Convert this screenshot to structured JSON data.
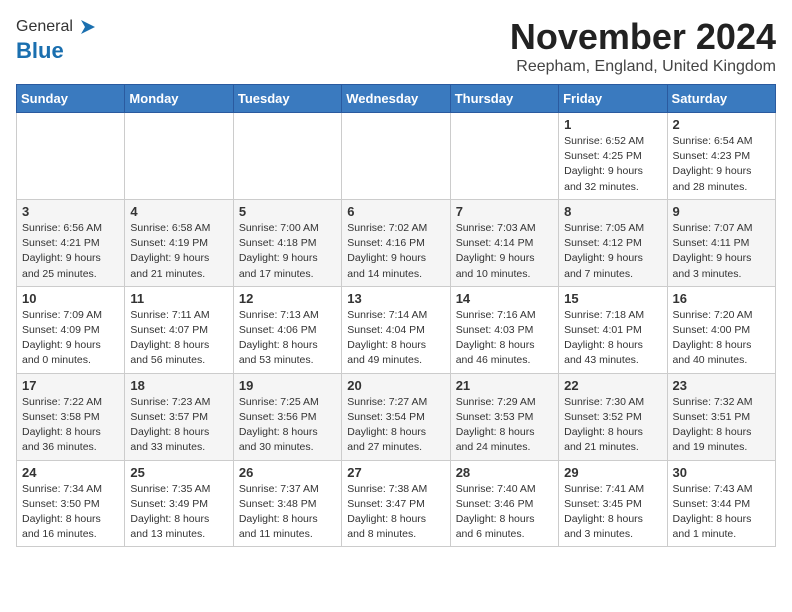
{
  "logo": {
    "general": "General",
    "blue": "Blue"
  },
  "title": "November 2024",
  "location": "Reepham, England, United Kingdom",
  "days_header": [
    "Sunday",
    "Monday",
    "Tuesday",
    "Wednesday",
    "Thursday",
    "Friday",
    "Saturday"
  ],
  "weeks": [
    [
      {
        "day": "",
        "detail": ""
      },
      {
        "day": "",
        "detail": ""
      },
      {
        "day": "",
        "detail": ""
      },
      {
        "day": "",
        "detail": ""
      },
      {
        "day": "",
        "detail": ""
      },
      {
        "day": "1",
        "detail": "Sunrise: 6:52 AM\nSunset: 4:25 PM\nDaylight: 9 hours\nand 32 minutes."
      },
      {
        "day": "2",
        "detail": "Sunrise: 6:54 AM\nSunset: 4:23 PM\nDaylight: 9 hours\nand 28 minutes."
      }
    ],
    [
      {
        "day": "3",
        "detail": "Sunrise: 6:56 AM\nSunset: 4:21 PM\nDaylight: 9 hours\nand 25 minutes."
      },
      {
        "day": "4",
        "detail": "Sunrise: 6:58 AM\nSunset: 4:19 PM\nDaylight: 9 hours\nand 21 minutes."
      },
      {
        "day": "5",
        "detail": "Sunrise: 7:00 AM\nSunset: 4:18 PM\nDaylight: 9 hours\nand 17 minutes."
      },
      {
        "day": "6",
        "detail": "Sunrise: 7:02 AM\nSunset: 4:16 PM\nDaylight: 9 hours\nand 14 minutes."
      },
      {
        "day": "7",
        "detail": "Sunrise: 7:03 AM\nSunset: 4:14 PM\nDaylight: 9 hours\nand 10 minutes."
      },
      {
        "day": "8",
        "detail": "Sunrise: 7:05 AM\nSunset: 4:12 PM\nDaylight: 9 hours\nand 7 minutes."
      },
      {
        "day": "9",
        "detail": "Sunrise: 7:07 AM\nSunset: 4:11 PM\nDaylight: 9 hours\nand 3 minutes."
      }
    ],
    [
      {
        "day": "10",
        "detail": "Sunrise: 7:09 AM\nSunset: 4:09 PM\nDaylight: 9 hours\nand 0 minutes."
      },
      {
        "day": "11",
        "detail": "Sunrise: 7:11 AM\nSunset: 4:07 PM\nDaylight: 8 hours\nand 56 minutes."
      },
      {
        "day": "12",
        "detail": "Sunrise: 7:13 AM\nSunset: 4:06 PM\nDaylight: 8 hours\nand 53 minutes."
      },
      {
        "day": "13",
        "detail": "Sunrise: 7:14 AM\nSunset: 4:04 PM\nDaylight: 8 hours\nand 49 minutes."
      },
      {
        "day": "14",
        "detail": "Sunrise: 7:16 AM\nSunset: 4:03 PM\nDaylight: 8 hours\nand 46 minutes."
      },
      {
        "day": "15",
        "detail": "Sunrise: 7:18 AM\nSunset: 4:01 PM\nDaylight: 8 hours\nand 43 minutes."
      },
      {
        "day": "16",
        "detail": "Sunrise: 7:20 AM\nSunset: 4:00 PM\nDaylight: 8 hours\nand 40 minutes."
      }
    ],
    [
      {
        "day": "17",
        "detail": "Sunrise: 7:22 AM\nSunset: 3:58 PM\nDaylight: 8 hours\nand 36 minutes."
      },
      {
        "day": "18",
        "detail": "Sunrise: 7:23 AM\nSunset: 3:57 PM\nDaylight: 8 hours\nand 33 minutes."
      },
      {
        "day": "19",
        "detail": "Sunrise: 7:25 AM\nSunset: 3:56 PM\nDaylight: 8 hours\nand 30 minutes."
      },
      {
        "day": "20",
        "detail": "Sunrise: 7:27 AM\nSunset: 3:54 PM\nDaylight: 8 hours\nand 27 minutes."
      },
      {
        "day": "21",
        "detail": "Sunrise: 7:29 AM\nSunset: 3:53 PM\nDaylight: 8 hours\nand 24 minutes."
      },
      {
        "day": "22",
        "detail": "Sunrise: 7:30 AM\nSunset: 3:52 PM\nDaylight: 8 hours\nand 21 minutes."
      },
      {
        "day": "23",
        "detail": "Sunrise: 7:32 AM\nSunset: 3:51 PM\nDaylight: 8 hours\nand 19 minutes."
      }
    ],
    [
      {
        "day": "24",
        "detail": "Sunrise: 7:34 AM\nSunset: 3:50 PM\nDaylight: 8 hours\nand 16 minutes."
      },
      {
        "day": "25",
        "detail": "Sunrise: 7:35 AM\nSunset: 3:49 PM\nDaylight: 8 hours\nand 13 minutes."
      },
      {
        "day": "26",
        "detail": "Sunrise: 7:37 AM\nSunset: 3:48 PM\nDaylight: 8 hours\nand 11 minutes."
      },
      {
        "day": "27",
        "detail": "Sunrise: 7:38 AM\nSunset: 3:47 PM\nDaylight: 8 hours\nand 8 minutes."
      },
      {
        "day": "28",
        "detail": "Sunrise: 7:40 AM\nSunset: 3:46 PM\nDaylight: 8 hours\nand 6 minutes."
      },
      {
        "day": "29",
        "detail": "Sunrise: 7:41 AM\nSunset: 3:45 PM\nDaylight: 8 hours\nand 3 minutes."
      },
      {
        "day": "30",
        "detail": "Sunrise: 7:43 AM\nSunset: 3:44 PM\nDaylight: 8 hours\nand 1 minute."
      }
    ]
  ]
}
